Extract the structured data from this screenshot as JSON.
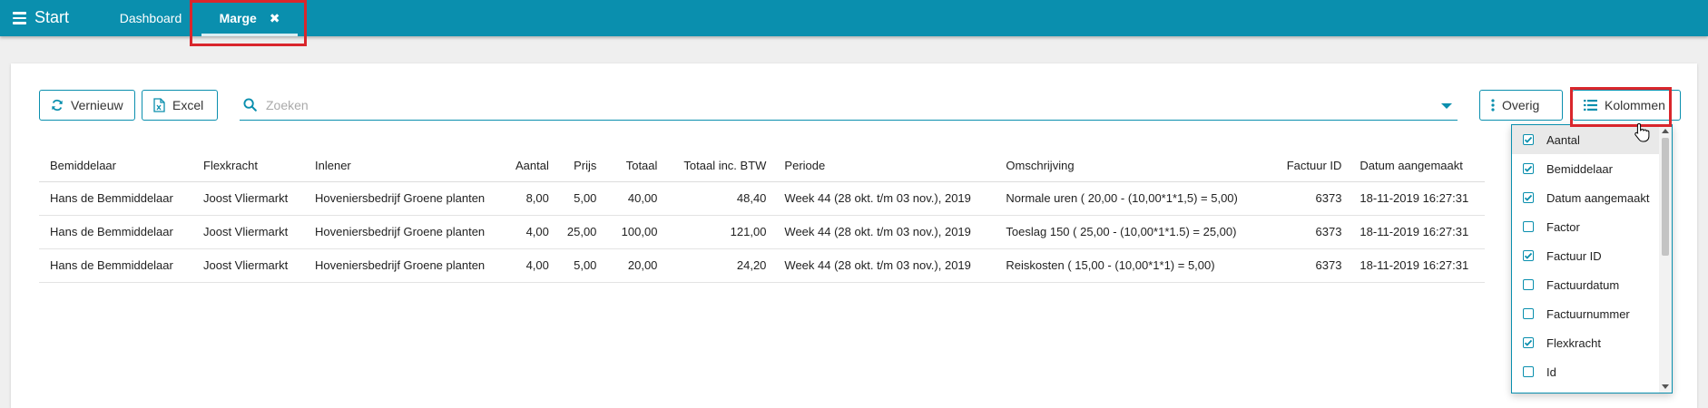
{
  "topbar": {
    "brand": "Start",
    "tabs": [
      {
        "label": "Dashboard"
      },
      {
        "label": "Marge",
        "close": "✖"
      }
    ]
  },
  "toolbar": {
    "refresh_label": "Vernieuw",
    "excel_label": "Excel",
    "search_placeholder": "Zoeken",
    "other_label": "Overig",
    "columns_label": "Kolommen"
  },
  "table": {
    "headers": [
      "Bemiddelaar",
      "Flexkracht",
      "Inlener",
      "Aantal",
      "Prijs",
      "Totaal",
      "Totaal inc. BTW",
      "Periode",
      "Omschrijving",
      "Factuur ID",
      "Datum aangemaakt"
    ],
    "rows": [
      [
        "Hans de Bemmiddelaar",
        "Joost Vliermarkt",
        "Hoveniersbedrijf Groene planten",
        "8,00",
        "5,00",
        "40,00",
        "48,40",
        "Week 44 (28 okt. t/m 03 nov.), 2019",
        "Normale uren ( 20,00 - (10,00*1*1,5) = 5,00)",
        "6373",
        "18-11-2019 16:27:31"
      ],
      [
        "Hans de Bemmiddelaar",
        "Joost Vliermarkt",
        "Hoveniersbedrijf Groene planten",
        "4,00",
        "25,00",
        "100,00",
        "121,00",
        "Week 44 (28 okt. t/m 03 nov.), 2019",
        "Toeslag 150 ( 25,00 - (10,00*1*1.5) = 25,00)",
        "6373",
        "18-11-2019 16:27:31"
      ],
      [
        "Hans de Bemmiddelaar",
        "Joost Vliermarkt",
        "Hoveniersbedrijf Groene planten",
        "4,00",
        "5,00",
        "20,00",
        "24,20",
        "Week 44 (28 okt. t/m 03 nov.), 2019",
        "Reiskosten ( 15,00 - (10,00*1*1) = 5,00)",
        "6373",
        "18-11-2019 16:27:31"
      ]
    ]
  },
  "column_menu": {
    "items": [
      {
        "label": "Aantal",
        "checked": true
      },
      {
        "label": "Bemiddelaar",
        "checked": true
      },
      {
        "label": "Datum aangemaakt",
        "checked": true
      },
      {
        "label": "Factor",
        "checked": false
      },
      {
        "label": "Factuur ID",
        "checked": true
      },
      {
        "label": "Factuurdatum",
        "checked": false
      },
      {
        "label": "Factuurnummer",
        "checked": false
      },
      {
        "label": "Flexkracht",
        "checked": true
      },
      {
        "label": "Id",
        "checked": false
      },
      {
        "label": "",
        "checked": true
      }
    ]
  },
  "colors": {
    "accent": "#0a8fae",
    "highlight": "#d9262c"
  }
}
